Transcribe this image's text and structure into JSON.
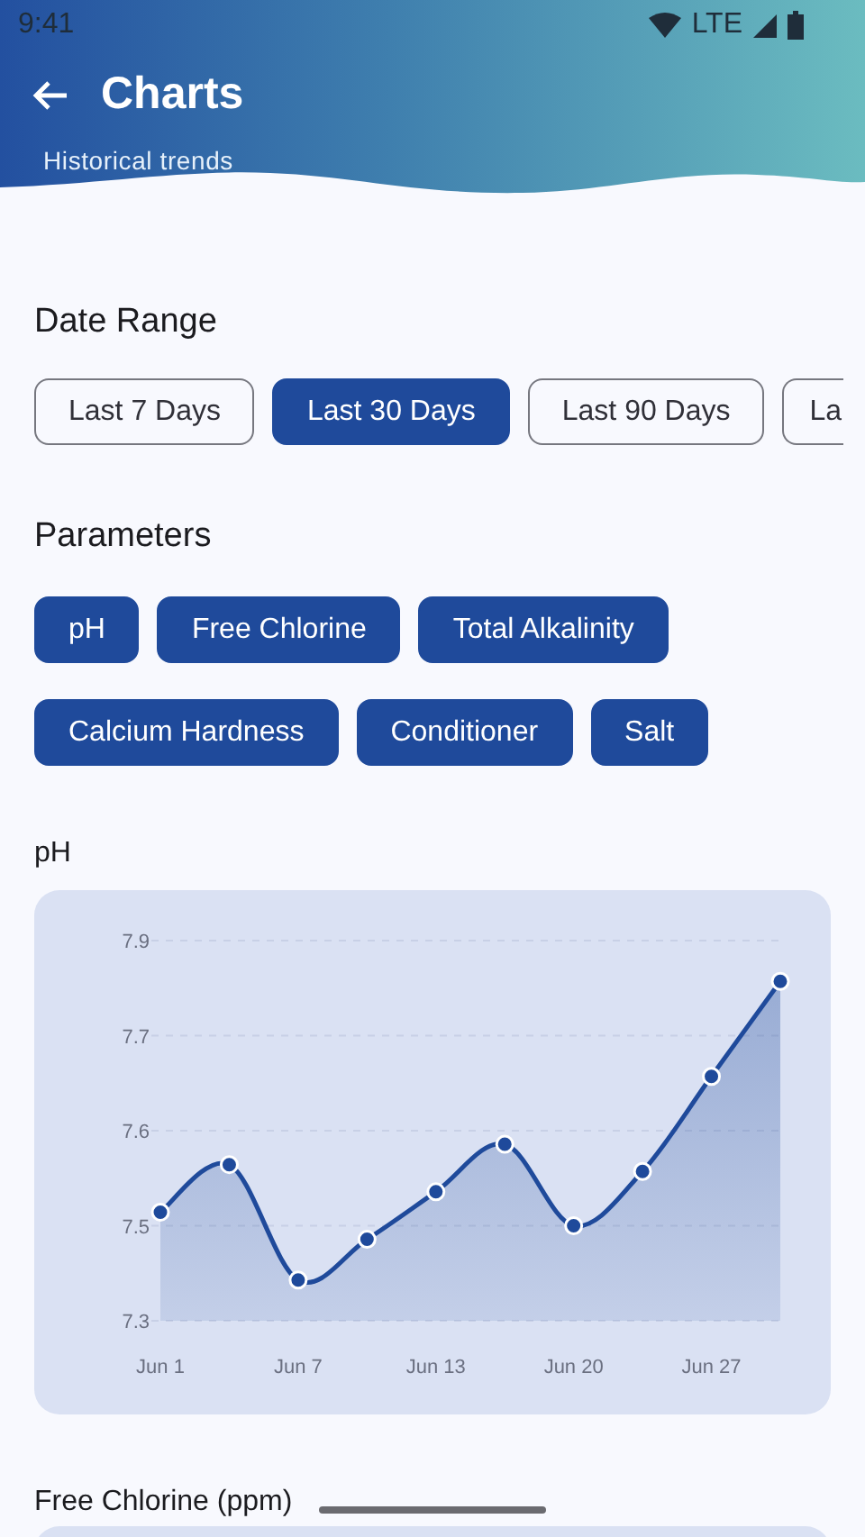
{
  "status_bar": {
    "time": "9:41",
    "network": "LTE"
  },
  "header": {
    "title": "Charts",
    "subtitle": "Historical trends"
  },
  "date_range": {
    "title": "Date Range",
    "options": [
      {
        "label": "Last 7 Days",
        "selected": false,
        "kind": "full"
      },
      {
        "label": "Last 30 Days",
        "selected": true,
        "kind": "full"
      },
      {
        "label": "Last 90 Days",
        "selected": false,
        "kind": "full"
      },
      {
        "label": "La",
        "selected": false,
        "kind": "partial"
      }
    ]
  },
  "parameters": {
    "title": "Parameters",
    "items": [
      {
        "label": "pH",
        "selected": true
      },
      {
        "label": "Free Chlorine",
        "selected": true
      },
      {
        "label": "Total Alkalinity",
        "selected": true
      },
      {
        "label": "Calcium Hardness",
        "selected": true
      },
      {
        "label": "Conditioner",
        "selected": true
      },
      {
        "label": "Salt",
        "selected": true
      }
    ]
  },
  "charts": [
    {
      "title": "pH",
      "chart_data": {
        "type": "area",
        "grid": true,
        "categories": [
          "Jun 1",
          null,
          "Jun 7",
          null,
          "Jun 13",
          null,
          "Jun 20",
          null,
          "Jun 27",
          null
        ],
        "series": [
          {
            "color": "#1f4a9b",
            "values": [
              7.48,
              7.55,
              7.38,
              7.44,
              7.51,
              7.58,
              7.46,
              7.54,
              7.68,
              7.82
            ]
          }
        ],
        "ylim": [
          7.32,
          7.88
        ],
        "yticks": [
          {
            "value": 7.32,
            "label": "7.3"
          },
          {
            "value": 7.46,
            "label": "7.5"
          },
          {
            "value": 7.6,
            "label": "7.6"
          },
          {
            "value": 7.74,
            "label": "7.7"
          },
          {
            "value": 7.88,
            "label": "7.9"
          }
        ]
      }
    },
    {
      "title": "Free Chlorine (ppm)"
    }
  ]
}
